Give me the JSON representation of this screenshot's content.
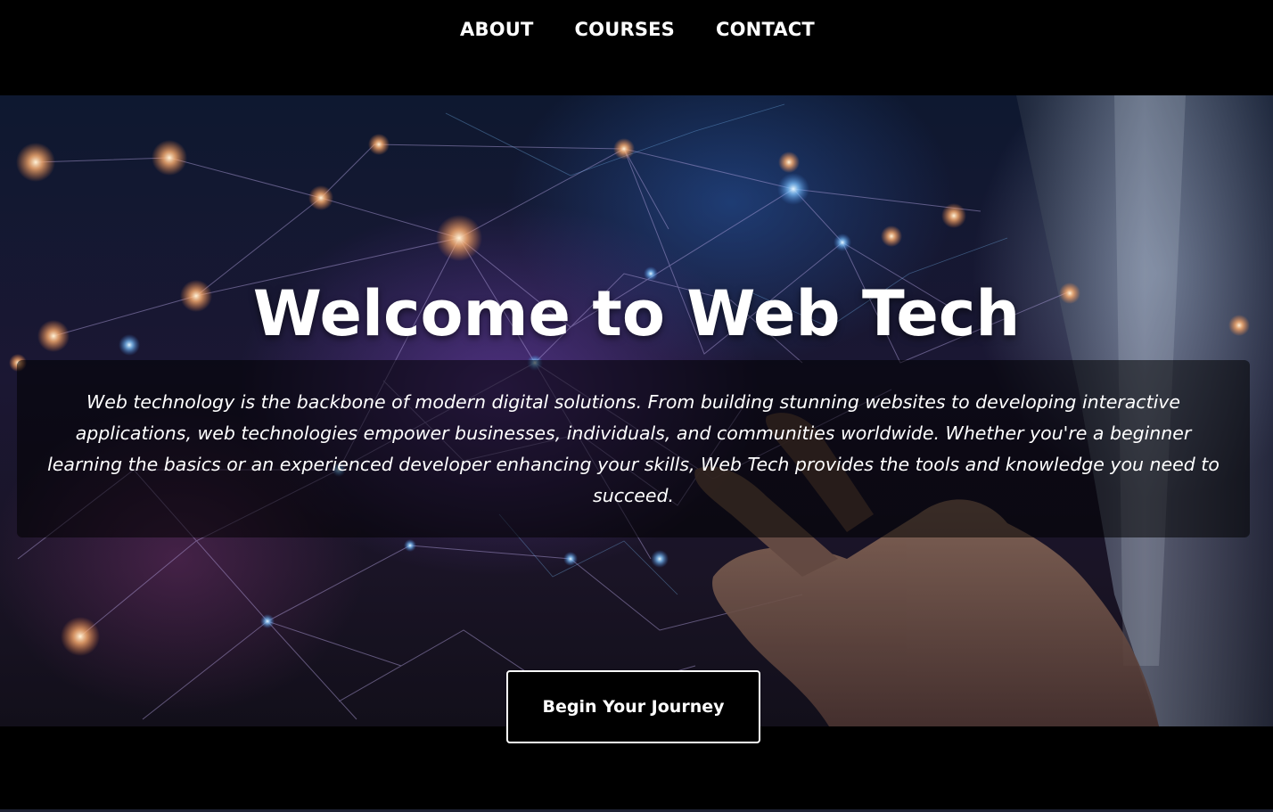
{
  "nav": {
    "items": [
      {
        "label": "ABOUT"
      },
      {
        "label": "COURSES"
      },
      {
        "label": "CONTACT"
      }
    ]
  },
  "hero": {
    "title": "Welcome to Web Tech",
    "description": "Web technology is the backbone of modern digital solutions. From building stunning websites to developing interactive applications, web technologies empower businesses, individuals, and communities worldwide. Whether you're a beginner learning the basics or an experienced developer enhancing your skills, Web Tech provides the tools and knowledge you need to succeed.",
    "cta_label": "Begin Your Journey"
  },
  "colors": {
    "background": "#000000",
    "text": "#ffffff",
    "node_warm": "#ffb070",
    "node_cool": "#7fc4ff",
    "network_line": "#b9a8e6"
  }
}
